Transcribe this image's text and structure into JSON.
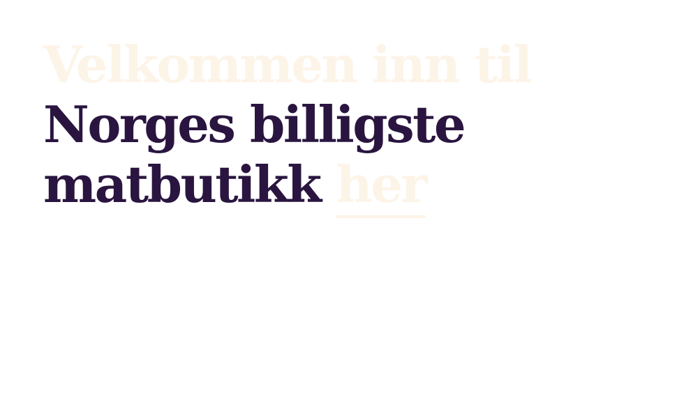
{
  "hero": {
    "line1": "Velkommen inn til",
    "line2": "Norges billigste",
    "line3": "matbutikk",
    "link_text": "her"
  },
  "colors": {
    "heading": "#2a1540",
    "faded": "#fdf4e8",
    "background": "#ffffff"
  }
}
